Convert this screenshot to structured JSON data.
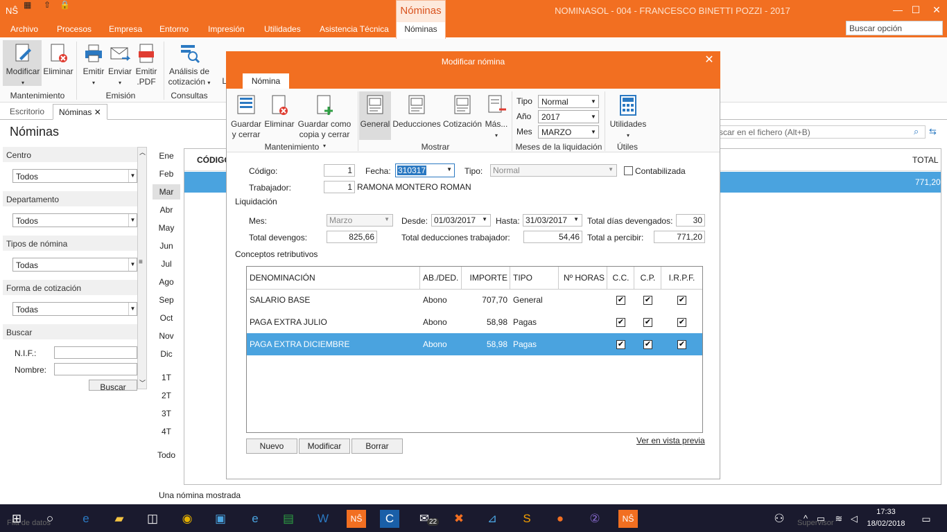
{
  "window": {
    "app_title": "NOMINASOL - 004 - FRANCESCO BINETTI POZZI - 2017",
    "context_tab": "Nóminas",
    "logo": "NŜ"
  },
  "menu": {
    "items": [
      "Archivo",
      "Procesos",
      "Empresa",
      "Entorno",
      "Impresión",
      "Utilidades",
      "Asistencia Técnica"
    ],
    "active": "Nóminas",
    "search_placeholder": "Buscar opción"
  },
  "ribbon": {
    "buttons": {
      "modificar": "Modificar",
      "eliminar": "Eliminar",
      "emitir": "Emitir",
      "enviar": "Enviar",
      "emitir_pdf_1": "Emitir",
      "emitir_pdf_2": ".PDF",
      "analisis_1": "Análisis de",
      "analisis_2": "cotización",
      "li": "Li"
    },
    "groups": {
      "mantenimiento": "Mantenimiento",
      "emision": "Emisión",
      "consultas": "Consultas"
    }
  },
  "doc_tabs": {
    "escritorio": "Escritorio",
    "nominas": "Nóminas"
  },
  "left_panel": {
    "title": "Nóminas",
    "centro": {
      "label": "Centro",
      "value": "Todos"
    },
    "departamento": {
      "label": "Departamento",
      "value": "Todos"
    },
    "tipos": {
      "label": "Tipos de nómina",
      "value": "Todas"
    },
    "forma": {
      "label": "Forma de cotización",
      "value": "Todas"
    },
    "buscar": {
      "label": "Buscar",
      "nif": "N.I.F.:",
      "nombre": "Nombre:",
      "button": "Buscar"
    }
  },
  "months": [
    "Ene",
    "Feb",
    "Mar",
    "Abr",
    "May",
    "Jun",
    "Jul",
    "Ago",
    "Sep",
    "Oct",
    "Nov",
    "Dic"
  ],
  "quarters": [
    "1T",
    "2T",
    "3T",
    "4T"
  ],
  "month_all": "Todo",
  "grid": {
    "col_codigo": "CÓDIGO",
    "col_total": "TOTAL",
    "row_total": "771,20",
    "search_placeholder": "scar en el fichero (Alt+B)"
  },
  "status": "Una nómina mostrada",
  "modal": {
    "title": "Modificar nómina",
    "tab": "Nómina",
    "buttons": {
      "guardar_1": "Guardar",
      "guardar_2": "y cerrar",
      "eliminar": "Eliminar",
      "copia_1": "Guardar como",
      "copia_2": "copia y cerrar",
      "general": "General",
      "deducciones": "Deducciones",
      "cotizacion": "Cotización",
      "mas": "Más...",
      "utilidades": "Utilidades"
    },
    "groups": {
      "mantenimiento": "Mantenimiento",
      "mostrar": "Mostrar",
      "meses": "Meses de la liquidación",
      "utiles": "Útiles"
    },
    "selectors": {
      "tipo_label": "Tipo",
      "tipo": "Normal",
      "ano_label": "Año",
      "ano": "2017",
      "mes_label": "Mes",
      "mes": "MARZO"
    },
    "form": {
      "codigo_label": "Código:",
      "codigo": "1",
      "fecha_label": "Fecha:",
      "fecha": "310317",
      "tipo_label": "Tipo:",
      "tipo": "Normal",
      "contabilizada": "Contabilizada",
      "trabajador_label": "Trabajador:",
      "trabajador_id": "1",
      "trabajador_name": "RAMONA MONTERO ROMAN"
    },
    "liquidacion": {
      "title": "Liquidación",
      "mes_label": "Mes:",
      "mes": "Marzo",
      "desde_label": "Desde:",
      "desde": "01/03/2017",
      "hasta_label": "Hasta:",
      "hasta": "31/03/2017",
      "dias_label": "Total días devengados:",
      "dias": "30",
      "devengos_label": "Total devengos:",
      "devengos": "825,66",
      "deducciones_label": "Total deducciones trabajador:",
      "deducciones": "54,46",
      "percibir_label": "Total a percibir:",
      "percibir": "771,20"
    },
    "conceptos": {
      "title": "Conceptos retributivos",
      "columns": [
        "DENOMINACIÓN",
        "AB./DED.",
        "IMPORTE",
        "TIPO",
        "Nº HORAS",
        "C.C.",
        "C.P.",
        "I.R.P.F."
      ],
      "rows": [
        {
          "denominacion": "SALARIO BASE",
          "abded": "Abono",
          "importe": "707,70",
          "tipo": "General",
          "horas": ""
        },
        {
          "denominacion": "PAGA EXTRA JULIO",
          "abded": "Abono",
          "importe": "58,98",
          "tipo": "Pagas",
          "horas": ""
        },
        {
          "denominacion": "PAGA EXTRA DICIEMBRE",
          "abded": "Abono",
          "importe": "58,98",
          "tipo": "Pagas",
          "horas": ""
        }
      ]
    },
    "actions": {
      "nuevo": "Nuevo",
      "modificar": "Modificar",
      "borrar": "Borrar",
      "preview": "Ver en vista previa"
    }
  },
  "taskbar": {
    "time": "17:33",
    "date": "18/02/2018",
    "mail_badge": "22",
    "status_left": "Fila de datos",
    "status_right": "Supervisor"
  }
}
